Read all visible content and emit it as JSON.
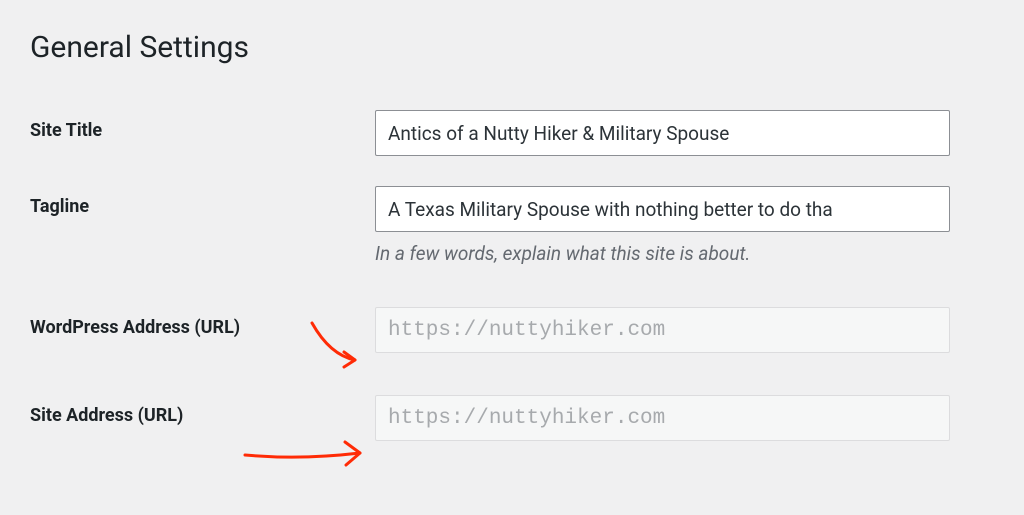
{
  "page": {
    "title": "General Settings"
  },
  "fields": {
    "site_title": {
      "label": "Site Title",
      "value": "Antics of a Nutty Hiker & Military Spouse"
    },
    "tagline": {
      "label": "Tagline",
      "value": "A Texas Military Spouse with nothing better to do tha",
      "description": "In a few words, explain what this site is about."
    },
    "wp_address": {
      "label": "WordPress Address (URL)",
      "value": "https://nuttyhiker.com"
    },
    "site_address": {
      "label": "Site Address (URL)",
      "value": "https://nuttyhiker.com"
    }
  },
  "annotation": {
    "arrow_color": "#ff2b06"
  }
}
